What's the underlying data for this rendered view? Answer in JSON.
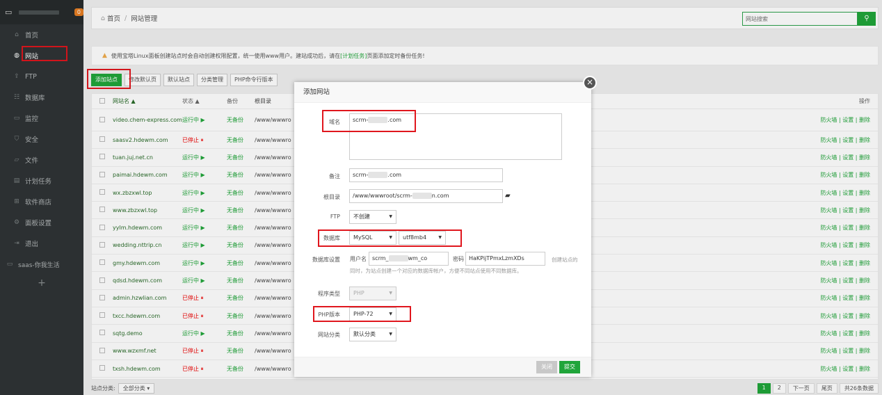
{
  "sidebar": {
    "badge": "0",
    "items": [
      {
        "label": "首页",
        "icon": "home-icon",
        "glyph": "⌂"
      },
      {
        "label": "网站",
        "icon": "globe-icon",
        "glyph": "◍"
      },
      {
        "label": "FTP",
        "icon": "ftp-icon",
        "glyph": "⇪"
      },
      {
        "label": "数据库",
        "icon": "database-icon",
        "glyph": "☷"
      },
      {
        "label": "监控",
        "icon": "monitor-icon",
        "glyph": "▭"
      },
      {
        "label": "安全",
        "icon": "shield-icon",
        "glyph": "⛉"
      },
      {
        "label": "文件",
        "icon": "folder-icon",
        "glyph": "▱"
      },
      {
        "label": "计划任务",
        "icon": "calendar-icon",
        "glyph": "▤"
      },
      {
        "label": "软件商店",
        "icon": "apps-icon",
        "glyph": "⊞"
      },
      {
        "label": "面板设置",
        "icon": "gear-icon",
        "glyph": "⚙"
      },
      {
        "label": "退出",
        "icon": "logout-icon",
        "glyph": "⇥"
      }
    ],
    "site": "saas-你我生活",
    "plus": "+"
  },
  "breadcrumb": {
    "home": "首页",
    "sep": "/",
    "current": "网站管理"
  },
  "search": {
    "placeholder": "网站搜索",
    "icon": "search-icon"
  },
  "notice": {
    "text_before": "使用宝塔Linux面板创建站点时会自动创建权限配置，统一使用www用户。建站成功后，请在",
    "link": "[计划任务]",
    "text_after": "页面添加定时备份任务!"
  },
  "toolbar": {
    "add_site": "添加站点",
    "modify_default": "修改默认页",
    "default_site": "默认站点",
    "category": "分类管理",
    "php_cli": "PHP命令行版本"
  },
  "table": {
    "headers": {
      "name": "网站名 ▲",
      "status": "状态 ▲",
      "backup": "备份",
      "root": "根目录",
      "action": "操作"
    },
    "rows": [
      {
        "name": "video.chem-express.com",
        "status": "运行中 ▶",
        "stopped": false
      },
      {
        "name": "saasv2.hdewm.com",
        "status": "已停止 ⏸",
        "stopped": true
      },
      {
        "name": "tuan.juj.net.cn",
        "status": "运行中 ▶",
        "stopped": false
      },
      {
        "name": "paimai.hdewm.com",
        "status": "运行中 ▶",
        "stopped": false
      },
      {
        "name": "wx.zbzxwl.top",
        "status": "运行中 ▶",
        "stopped": false
      },
      {
        "name": "www.zbzxwl.top",
        "status": "运行中 ▶",
        "stopped": false
      },
      {
        "name": "yylm.hdewm.com",
        "status": "运行中 ▶",
        "stopped": false
      },
      {
        "name": "wedding.nttrip.cn",
        "status": "运行中 ▶",
        "stopped": false
      },
      {
        "name": "gmy.hdewm.com",
        "status": "运行中 ▶",
        "stopped": false
      },
      {
        "name": "qdsd.hdewm.com",
        "status": "运行中 ▶",
        "stopped": false
      },
      {
        "name": "admin.hzwlian.com",
        "status": "已停止 ⏸",
        "stopped": true
      },
      {
        "name": "txcc.hdewm.com",
        "status": "已停止 ⏸",
        "stopped": true
      },
      {
        "name": "sqtg.demo",
        "status": "运行中 ▶",
        "stopped": false
      },
      {
        "name": "www.wzxmf.net",
        "status": "已停止 ⏸",
        "stopped": true
      },
      {
        "name": "txsh.hdewm.com",
        "status": "已停止 ⏸",
        "stopped": true
      }
    ],
    "backup_text": "无备份",
    "root_text": "/www/wwwro",
    "actions": "防火墙 | 设置 | 删除"
  },
  "pager": {
    "category_label": "站点分类:",
    "category_value": "全部分类",
    "pages": [
      "1",
      "2",
      "下一页",
      "尾页",
      "共26条数据"
    ]
  },
  "modal": {
    "title": "添加网站",
    "close_glyph": "×",
    "domain_label": "域名",
    "domain_prefix": "scrm-",
    "domain_suffix": ".com",
    "remark_label": "备注",
    "remark_prefix": "scrm-",
    "remark_suffix": ".com",
    "root_label": "根目录",
    "root_prefix": "/www/wwwroot/scrm-",
    "root_suffix": "n.com",
    "folder_icon": "folder-icon",
    "ftp_label": "FTP",
    "ftp_value": "不创建",
    "db_label": "数据库",
    "db_value": "MySQL",
    "db_charset": "utf8mb4",
    "db_settings_label": "数据库设置",
    "db_user_label": "用户名",
    "db_user_prefix": "scrm_",
    "db_user_suffix": "wm_co",
    "db_pass_label": "密码",
    "db_pass_value": "HaKPijTPmxLzmXDs",
    "db_hint_1": "创建站点的",
    "db_hint_2": "同时，为站点创建一个对应的数据库帐户，方便不同站点使用不同数据库。",
    "program_label": "程序类型",
    "program_value": "PHP",
    "php_label": "PHP版本",
    "php_value": "PHP-72",
    "category_label": "网站分类",
    "category_value": "默认分类",
    "close_btn": "关闭",
    "submit_btn": "提交"
  },
  "colors": {
    "accent": "#20a53a",
    "sidebar": "#2f3436",
    "highlight": "#e0161d",
    "stopped": "#ee0000"
  }
}
